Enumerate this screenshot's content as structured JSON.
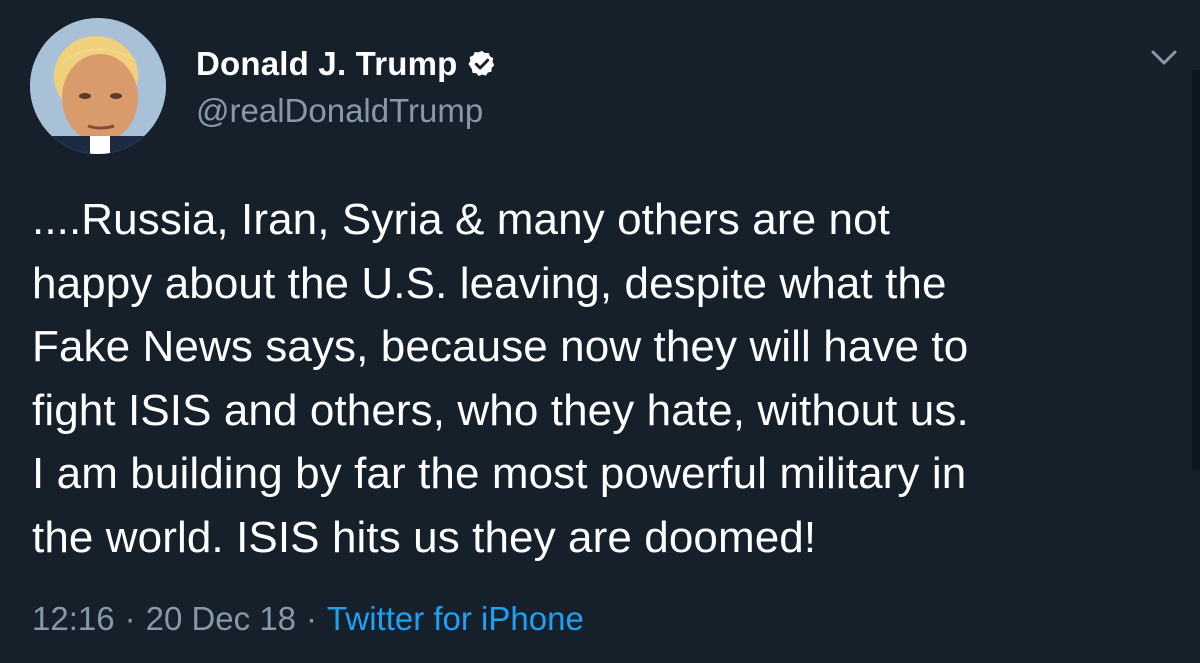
{
  "user": {
    "display_name": "Donald J. Trump",
    "handle": "@realDonaldTrump",
    "verified": true
  },
  "icons": {
    "verified": "verified-badge-icon",
    "menu": "chevron-down-icon"
  },
  "tweet": {
    "lines": [
      "....Russia, Iran, Syria & many others are not",
      "happy about the U.S. leaving, despite what the",
      "Fake News says, because now they will have to",
      "fight ISIS and others, who they hate, without us.",
      "I am building by far the most powerful military in",
      "the world. ISIS hits us they are doomed!"
    ]
  },
  "meta": {
    "time": "12:16",
    "separator": "·",
    "date": "20 Dec 18",
    "source": "Twitter for iPhone"
  },
  "colors": {
    "background": "#15202b",
    "text": "#ffffff",
    "secondary_text": "#8899a6",
    "link": "#1da1f2"
  }
}
